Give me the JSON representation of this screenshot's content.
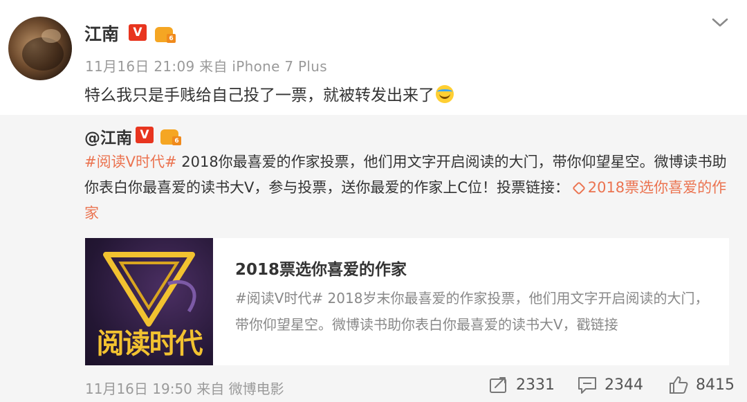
{
  "post": {
    "username": "江南",
    "v_badge": "V",
    "level": "6",
    "meta": "11月16日 21:09 来自 iPhone 7 Plus",
    "content": "特么我只是手贱给自己投了一票，就被转发出来了"
  },
  "repost": {
    "username": "@江南",
    "v_badge": "V",
    "level": "6",
    "topic": "#阅读V时代#",
    "text": " 2018你最喜爱的作家投票，他们用文字开启阅读的大门，带你仰望星空。微博读书助你表白你最喜爱的读书大V，参与投票，送你最爱的作家上C位！投票链接：",
    "link": "2018票选你喜爱的作家",
    "card": {
      "thumb_text": "阅读时代",
      "title": "2018票选你喜爱的作家",
      "desc": "#阅读V时代# 2018岁末你最喜爱的作家投票，他们用文字开启阅读的大门，带你仰望星空。微博读书助你表白你最喜爱的读书大V，戳链接"
    },
    "meta": "11月16日 19:50 来自 微博电影",
    "stats": {
      "reposts": "2331",
      "comments": "2344",
      "likes": "8415"
    }
  },
  "colors": {
    "accent": "#eb7350",
    "v_badge": "#e8351f",
    "repost_bg": "#f5f5f5"
  }
}
